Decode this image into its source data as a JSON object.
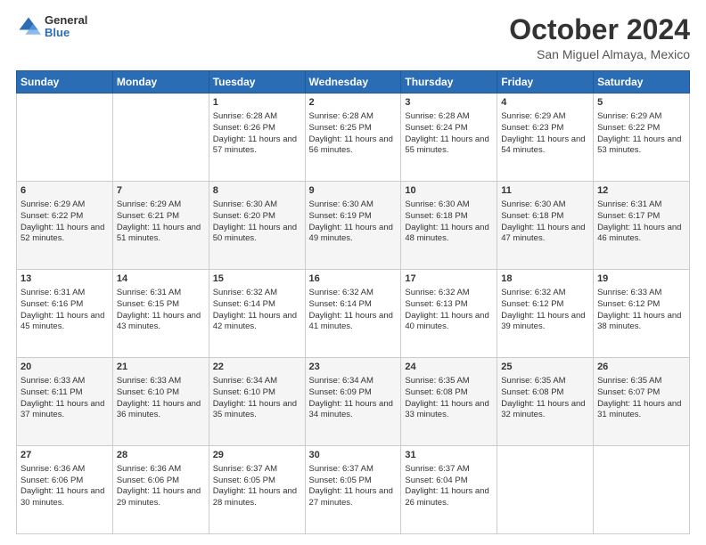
{
  "header": {
    "logo": {
      "general": "General",
      "blue": "Blue"
    },
    "title": "October 2024",
    "location": "San Miguel Almaya, Mexico"
  },
  "days_of_week": [
    "Sunday",
    "Monday",
    "Tuesday",
    "Wednesday",
    "Thursday",
    "Friday",
    "Saturday"
  ],
  "weeks": [
    [
      {
        "day": "",
        "sunrise": "",
        "sunset": "",
        "daylight": ""
      },
      {
        "day": "",
        "sunrise": "",
        "sunset": "",
        "daylight": ""
      },
      {
        "day": "1",
        "sunrise": "Sunrise: 6:28 AM",
        "sunset": "Sunset: 6:26 PM",
        "daylight": "Daylight: 11 hours and 57 minutes."
      },
      {
        "day": "2",
        "sunrise": "Sunrise: 6:28 AM",
        "sunset": "Sunset: 6:25 PM",
        "daylight": "Daylight: 11 hours and 56 minutes."
      },
      {
        "day": "3",
        "sunrise": "Sunrise: 6:28 AM",
        "sunset": "Sunset: 6:24 PM",
        "daylight": "Daylight: 11 hours and 55 minutes."
      },
      {
        "day": "4",
        "sunrise": "Sunrise: 6:29 AM",
        "sunset": "Sunset: 6:23 PM",
        "daylight": "Daylight: 11 hours and 54 minutes."
      },
      {
        "day": "5",
        "sunrise": "Sunrise: 6:29 AM",
        "sunset": "Sunset: 6:22 PM",
        "daylight": "Daylight: 11 hours and 53 minutes."
      }
    ],
    [
      {
        "day": "6",
        "sunrise": "Sunrise: 6:29 AM",
        "sunset": "Sunset: 6:22 PM",
        "daylight": "Daylight: 11 hours and 52 minutes."
      },
      {
        "day": "7",
        "sunrise": "Sunrise: 6:29 AM",
        "sunset": "Sunset: 6:21 PM",
        "daylight": "Daylight: 11 hours and 51 minutes."
      },
      {
        "day": "8",
        "sunrise": "Sunrise: 6:30 AM",
        "sunset": "Sunset: 6:20 PM",
        "daylight": "Daylight: 11 hours and 50 minutes."
      },
      {
        "day": "9",
        "sunrise": "Sunrise: 6:30 AM",
        "sunset": "Sunset: 6:19 PM",
        "daylight": "Daylight: 11 hours and 49 minutes."
      },
      {
        "day": "10",
        "sunrise": "Sunrise: 6:30 AM",
        "sunset": "Sunset: 6:18 PM",
        "daylight": "Daylight: 11 hours and 48 minutes."
      },
      {
        "day": "11",
        "sunrise": "Sunrise: 6:30 AM",
        "sunset": "Sunset: 6:18 PM",
        "daylight": "Daylight: 11 hours and 47 minutes."
      },
      {
        "day": "12",
        "sunrise": "Sunrise: 6:31 AM",
        "sunset": "Sunset: 6:17 PM",
        "daylight": "Daylight: 11 hours and 46 minutes."
      }
    ],
    [
      {
        "day": "13",
        "sunrise": "Sunrise: 6:31 AM",
        "sunset": "Sunset: 6:16 PM",
        "daylight": "Daylight: 11 hours and 45 minutes."
      },
      {
        "day": "14",
        "sunrise": "Sunrise: 6:31 AM",
        "sunset": "Sunset: 6:15 PM",
        "daylight": "Daylight: 11 hours and 43 minutes."
      },
      {
        "day": "15",
        "sunrise": "Sunrise: 6:32 AM",
        "sunset": "Sunset: 6:14 PM",
        "daylight": "Daylight: 11 hours and 42 minutes."
      },
      {
        "day": "16",
        "sunrise": "Sunrise: 6:32 AM",
        "sunset": "Sunset: 6:14 PM",
        "daylight": "Daylight: 11 hours and 41 minutes."
      },
      {
        "day": "17",
        "sunrise": "Sunrise: 6:32 AM",
        "sunset": "Sunset: 6:13 PM",
        "daylight": "Daylight: 11 hours and 40 minutes."
      },
      {
        "day": "18",
        "sunrise": "Sunrise: 6:32 AM",
        "sunset": "Sunset: 6:12 PM",
        "daylight": "Daylight: 11 hours and 39 minutes."
      },
      {
        "day": "19",
        "sunrise": "Sunrise: 6:33 AM",
        "sunset": "Sunset: 6:12 PM",
        "daylight": "Daylight: 11 hours and 38 minutes."
      }
    ],
    [
      {
        "day": "20",
        "sunrise": "Sunrise: 6:33 AM",
        "sunset": "Sunset: 6:11 PM",
        "daylight": "Daylight: 11 hours and 37 minutes."
      },
      {
        "day": "21",
        "sunrise": "Sunrise: 6:33 AM",
        "sunset": "Sunset: 6:10 PM",
        "daylight": "Daylight: 11 hours and 36 minutes."
      },
      {
        "day": "22",
        "sunrise": "Sunrise: 6:34 AM",
        "sunset": "Sunset: 6:10 PM",
        "daylight": "Daylight: 11 hours and 35 minutes."
      },
      {
        "day": "23",
        "sunrise": "Sunrise: 6:34 AM",
        "sunset": "Sunset: 6:09 PM",
        "daylight": "Daylight: 11 hours and 34 minutes."
      },
      {
        "day": "24",
        "sunrise": "Sunrise: 6:35 AM",
        "sunset": "Sunset: 6:08 PM",
        "daylight": "Daylight: 11 hours and 33 minutes."
      },
      {
        "day": "25",
        "sunrise": "Sunrise: 6:35 AM",
        "sunset": "Sunset: 6:08 PM",
        "daylight": "Daylight: 11 hours and 32 minutes."
      },
      {
        "day": "26",
        "sunrise": "Sunrise: 6:35 AM",
        "sunset": "Sunset: 6:07 PM",
        "daylight": "Daylight: 11 hours and 31 minutes."
      }
    ],
    [
      {
        "day": "27",
        "sunrise": "Sunrise: 6:36 AM",
        "sunset": "Sunset: 6:06 PM",
        "daylight": "Daylight: 11 hours and 30 minutes."
      },
      {
        "day": "28",
        "sunrise": "Sunrise: 6:36 AM",
        "sunset": "Sunset: 6:06 PM",
        "daylight": "Daylight: 11 hours and 29 minutes."
      },
      {
        "day": "29",
        "sunrise": "Sunrise: 6:37 AM",
        "sunset": "Sunset: 6:05 PM",
        "daylight": "Daylight: 11 hours and 28 minutes."
      },
      {
        "day": "30",
        "sunrise": "Sunrise: 6:37 AM",
        "sunset": "Sunset: 6:05 PM",
        "daylight": "Daylight: 11 hours and 27 minutes."
      },
      {
        "day": "31",
        "sunrise": "Sunrise: 6:37 AM",
        "sunset": "Sunset: 6:04 PM",
        "daylight": "Daylight: 11 hours and 26 minutes."
      },
      {
        "day": "",
        "sunrise": "",
        "sunset": "",
        "daylight": ""
      },
      {
        "day": "",
        "sunrise": "",
        "sunset": "",
        "daylight": ""
      }
    ]
  ]
}
